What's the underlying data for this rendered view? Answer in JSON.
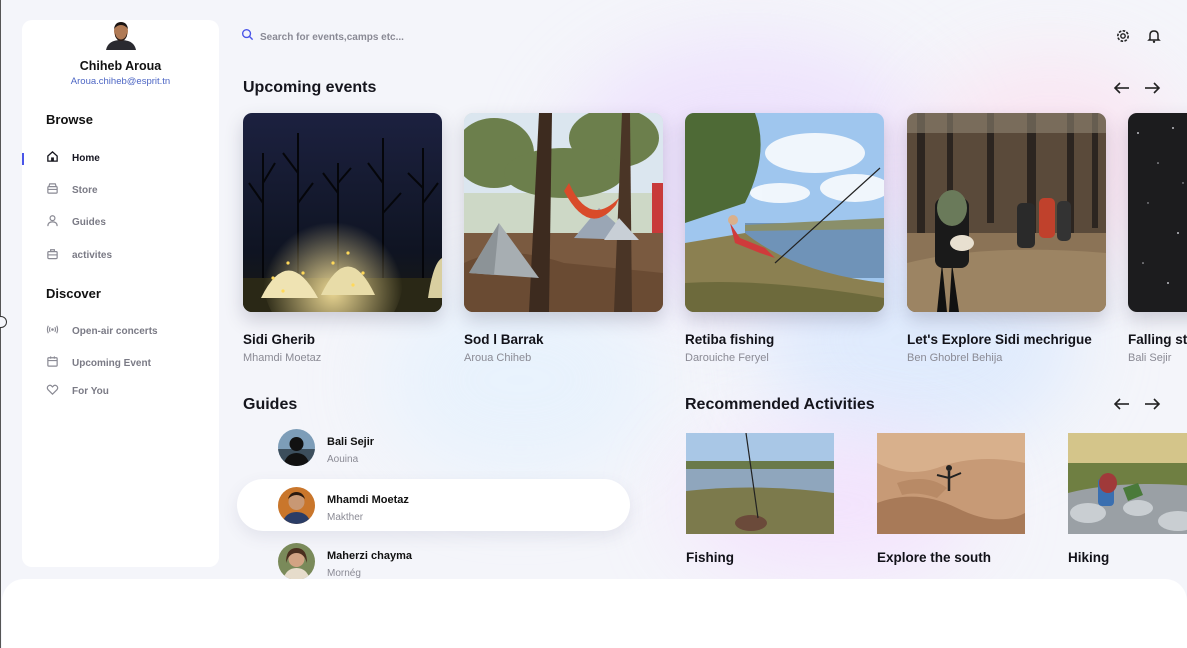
{
  "profile": {
    "name": "Chiheb Aroua",
    "email": "Aroua.chiheb@esprit.tn"
  },
  "sidebar": {
    "browse_title": "Browse",
    "browse_items": [
      {
        "label": "Home",
        "icon": "home-icon",
        "active": true
      },
      {
        "label": "Store",
        "icon": "store-icon"
      },
      {
        "label": "Guides",
        "icon": "user-icon"
      },
      {
        "label": "activites",
        "icon": "bag-icon"
      }
    ],
    "discover_title": "Discover",
    "discover_items": [
      {
        "label": "Open-air concerts",
        "icon": "broadcast-icon"
      },
      {
        "label": "Upcoming Event",
        "icon": "calendar-icon"
      },
      {
        "label": "For You",
        "icon": "heart-icon"
      }
    ]
  },
  "search": {
    "placeholder": "Search for events,camps etc..."
  },
  "events": {
    "title": "Upcoming events",
    "items": [
      {
        "title": "Sidi Gherib",
        "author": "Mhamdi Moetaz"
      },
      {
        "title": "Sod l Barrak",
        "author": "Aroua Chiheb"
      },
      {
        "title": "Retiba fishing",
        "author": "Darouiche Feryel"
      },
      {
        "title": "Let's Explore Sidi mechrigue",
        "author": "Ben Ghobrel Behija"
      },
      {
        "title": "Falling st",
        "author": "Bali Sejir"
      }
    ]
  },
  "guides": {
    "title": "Guides",
    "items": [
      {
        "name": "Bali Sejir",
        "location": "Aouina"
      },
      {
        "name": "Mhamdi Moetaz",
        "location": "Makther",
        "highlighted": true
      },
      {
        "name": "Maherzi chayma",
        "location": "Mornég"
      }
    ]
  },
  "activities": {
    "title": "Recommended Activities",
    "items": [
      {
        "title": "Fishing"
      },
      {
        "title": "Explore the south"
      },
      {
        "title": "Hiking"
      }
    ]
  },
  "colors": {
    "accent": "#4a55e8",
    "email": "#4d66c4",
    "muted": "#8a8a94"
  }
}
